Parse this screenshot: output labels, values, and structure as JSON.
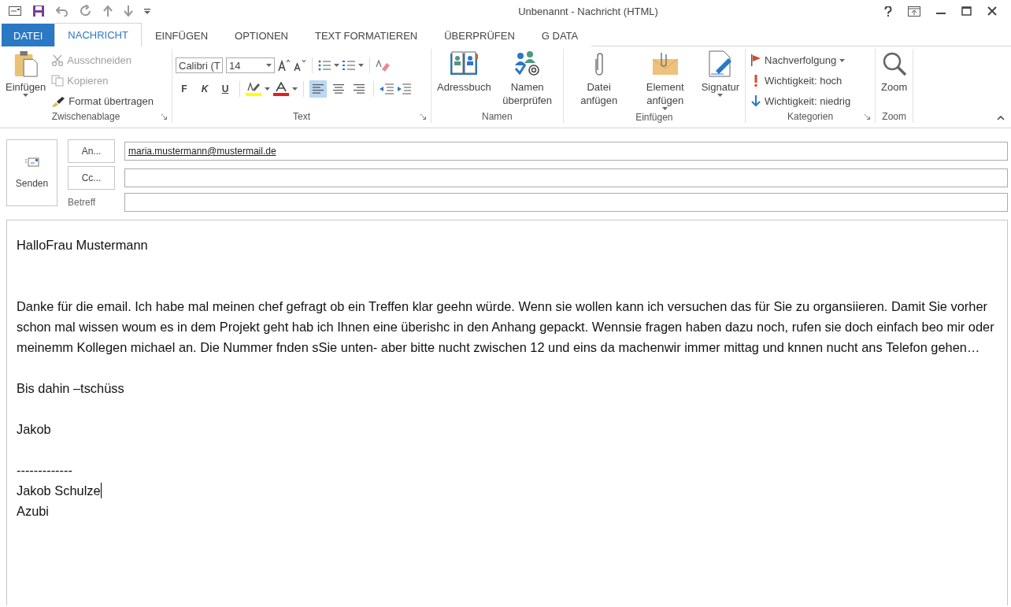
{
  "window": {
    "title": "Unbenannt - Nachricht (HTML)"
  },
  "tabs": [
    {
      "label": "DATEI",
      "kind": "file",
      "selected": false
    },
    {
      "label": "NACHRICHT",
      "kind": "tab",
      "selected": true
    },
    {
      "label": "EINFÜGEN",
      "kind": "tab",
      "selected": false
    },
    {
      "label": "OPTIONEN",
      "kind": "tab",
      "selected": false
    },
    {
      "label": "TEXT FORMATIEREN",
      "kind": "tab",
      "selected": false
    },
    {
      "label": "ÜBERPRÜFEN",
      "kind": "tab",
      "selected": false
    },
    {
      "label": "G DATA",
      "kind": "tab",
      "selected": false
    }
  ],
  "ribbon": {
    "clipboard": {
      "label": "Zwischenablage",
      "paste": "Einfügen",
      "items": [
        {
          "label": "Ausschneiden",
          "disabled": true
        },
        {
          "label": "Kopieren",
          "disabled": true
        },
        {
          "label": "Format übertragen",
          "disabled": false
        }
      ]
    },
    "text": {
      "label": "Text",
      "font": "Calibri (T",
      "size": "14",
      "styles": [
        "F",
        "K",
        "U"
      ],
      "align": [
        {
          "selected": true
        },
        {
          "selected": false
        },
        {
          "selected": false
        }
      ]
    },
    "names": {
      "label": "Namen",
      "buttons": [
        "Adressbuch",
        "Namen überprüfen"
      ]
    },
    "insert": {
      "label": "Einfügen",
      "buttons": [
        "Datei anfügen",
        "Element anfügen",
        "Signatur"
      ]
    },
    "categories": {
      "label": "Kategorien",
      "items": [
        "Nachverfolgung",
        "Wichtigkeit: hoch",
        "Wichtigkeit: niedrig"
      ]
    },
    "zoom": {
      "label": "Zoom",
      "button": "Zoom"
    }
  },
  "header": {
    "send": "Senden",
    "to_button": "An...",
    "to": "maria.mustermann@mustermail.de",
    "cc_button": "Cc...",
    "subject_label": "Betreff"
  },
  "body": {
    "paragraphs": [
      [
        "HalloFrau Mustermann"
      ],
      [
        "Danke für die email. Ich habe mal meinen chef gefragt ob ein Treffen klar geehn würde. Wenn sie wollen kann ich versuchen das für Sie zu organsiieren. Damit Sie vorher schon mal wissen woum es in dem Projekt geht hab ich Ihnen eine überishc in den Anhang gepackt. Wennsie fragen haben dazu noch, rufen sie doch einfach beo mir oder meinemm Kollegen michael an. Die Nummer fnden sSie unten- aber bitte nucht zwischen 12 und eins da machenwir immer mittag und knnen nucht ans Telefon gehen…"
      ],
      [
        "Bis dahin –tschüss"
      ],
      [
        "Jakob"
      ],
      [
        "-------------",
        "Jakob Schulze",
        "Azubi"
      ]
    ]
  }
}
